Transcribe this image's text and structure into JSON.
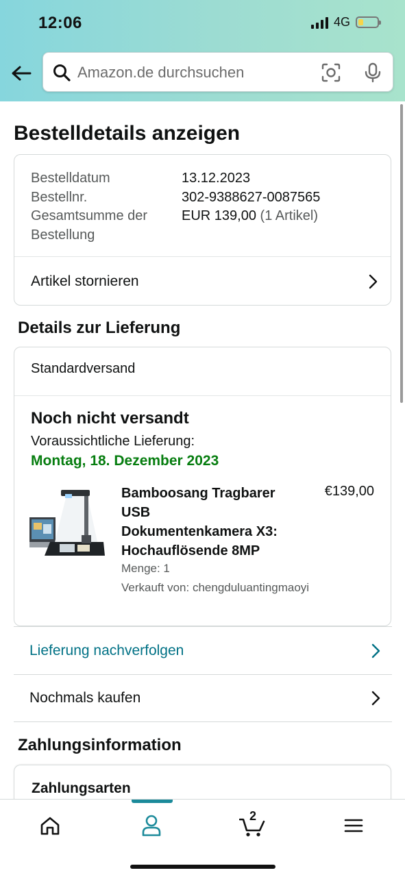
{
  "status_bar": {
    "time": "12:06",
    "network": "4G"
  },
  "search": {
    "placeholder": "Amazon.de durchsuchen"
  },
  "page": {
    "title": "Bestelldetails anzeigen"
  },
  "order": {
    "date_label": "Bestelldatum",
    "date_value": "13.12.2023",
    "number_label": "Bestellnr.",
    "number_value": "302-9388627-0087565",
    "total_label_line1": "Gesamtsumme der",
    "total_label_line2": "Bestellung",
    "total_value": "EUR 139,00",
    "total_items": "(1 Artikel)",
    "cancel_label": "Artikel stornieren"
  },
  "delivery": {
    "section_title": "Details zur Lieferung",
    "method": "Standardversand",
    "status": "Noch nicht versandt",
    "expected_label": "Voraussichtliche Lieferung:",
    "expected_date": "Montag, 18. Dezember 2023",
    "product": {
      "title_line1": "Bamboosang Tragbarer",
      "title_line2": "USB",
      "title_line3": "Dokumentenkamera X3:",
      "title_line4": "Hochauflösende 8MP",
      "price": "€139,00",
      "quantity": "Menge: 1",
      "seller": "Verkauft von: chengduluantingmaoyi"
    },
    "track_label": "Lieferung nachverfolgen",
    "buy_again_label": "Nochmals kaufen"
  },
  "payment": {
    "section_title": "Zahlungsinformation",
    "subtitle": "Zahlungsarten"
  },
  "nav": {
    "cart_count": "2",
    "active_tab": "account"
  },
  "colors": {
    "accent_teal": "#007185",
    "delivery_green": "#067d0f",
    "header_gradient_start": "#86d6dd",
    "header_gradient_end": "#a8e3cc"
  },
  "icons": [
    "back-arrow-icon",
    "search-icon",
    "camera-lens-icon",
    "microphone-icon",
    "chevron-right-icon",
    "home-icon",
    "person-icon",
    "cart-icon",
    "menu-icon"
  ]
}
